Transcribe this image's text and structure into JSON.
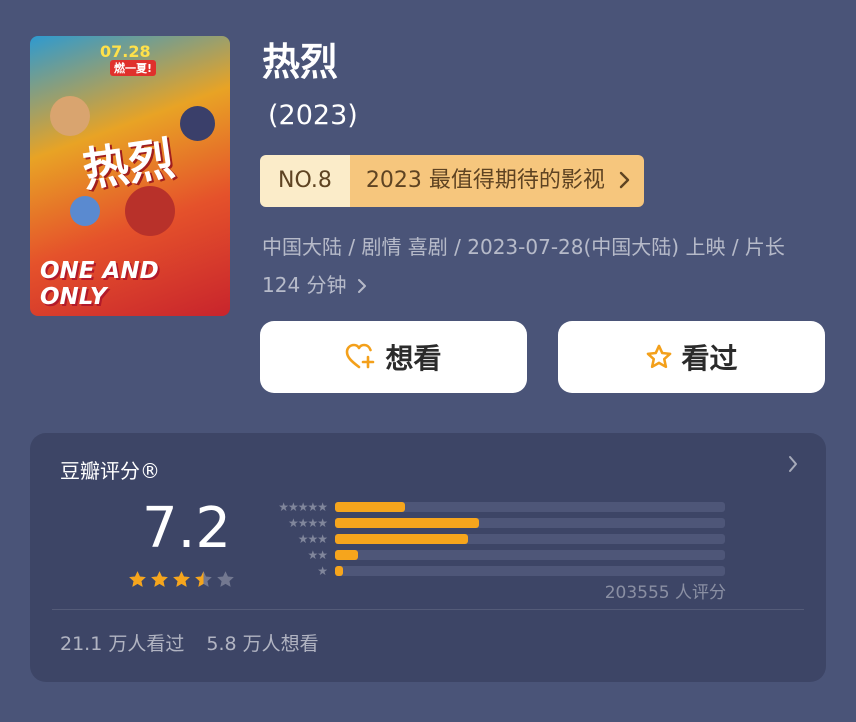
{
  "poster": {
    "date": "07.28",
    "tagline": "燃一夏!",
    "title_art": "热烈",
    "english_title": "ONE AND ONLY"
  },
  "movie": {
    "title": "热烈",
    "year": "(2023)",
    "info": "中国大陆 / 剧情 喜剧 / 2023-07-28(中国大陆) 上映 / 片长124 分钟"
  },
  "rank": {
    "number": "NO.8",
    "label": "2023 最值得期待的影视"
  },
  "buttons": {
    "want": "想看",
    "seen": "看过"
  },
  "rating": {
    "title": "豆瓣评分®",
    "score": "7.2",
    "stars_filled": 3.5,
    "stars_total": 5,
    "distribution": [
      {
        "stars": 5,
        "fraction": 0.18
      },
      {
        "stars": 4,
        "fraction": 0.37
      },
      {
        "stars": 3,
        "fraction": 0.34
      },
      {
        "stars": 2,
        "fraction": 0.06
      },
      {
        "stars": 1,
        "fraction": 0.02
      }
    ],
    "count_text": "203555 人评分",
    "watched_text": "21.1 万人看过",
    "want_text": "5.8 万人想看"
  },
  "colors": {
    "background": "#4a5478",
    "card": "#3d4566",
    "accent": "#f6a51c",
    "rank_left": "#fbecc9",
    "rank_right": "#f6c67d"
  }
}
